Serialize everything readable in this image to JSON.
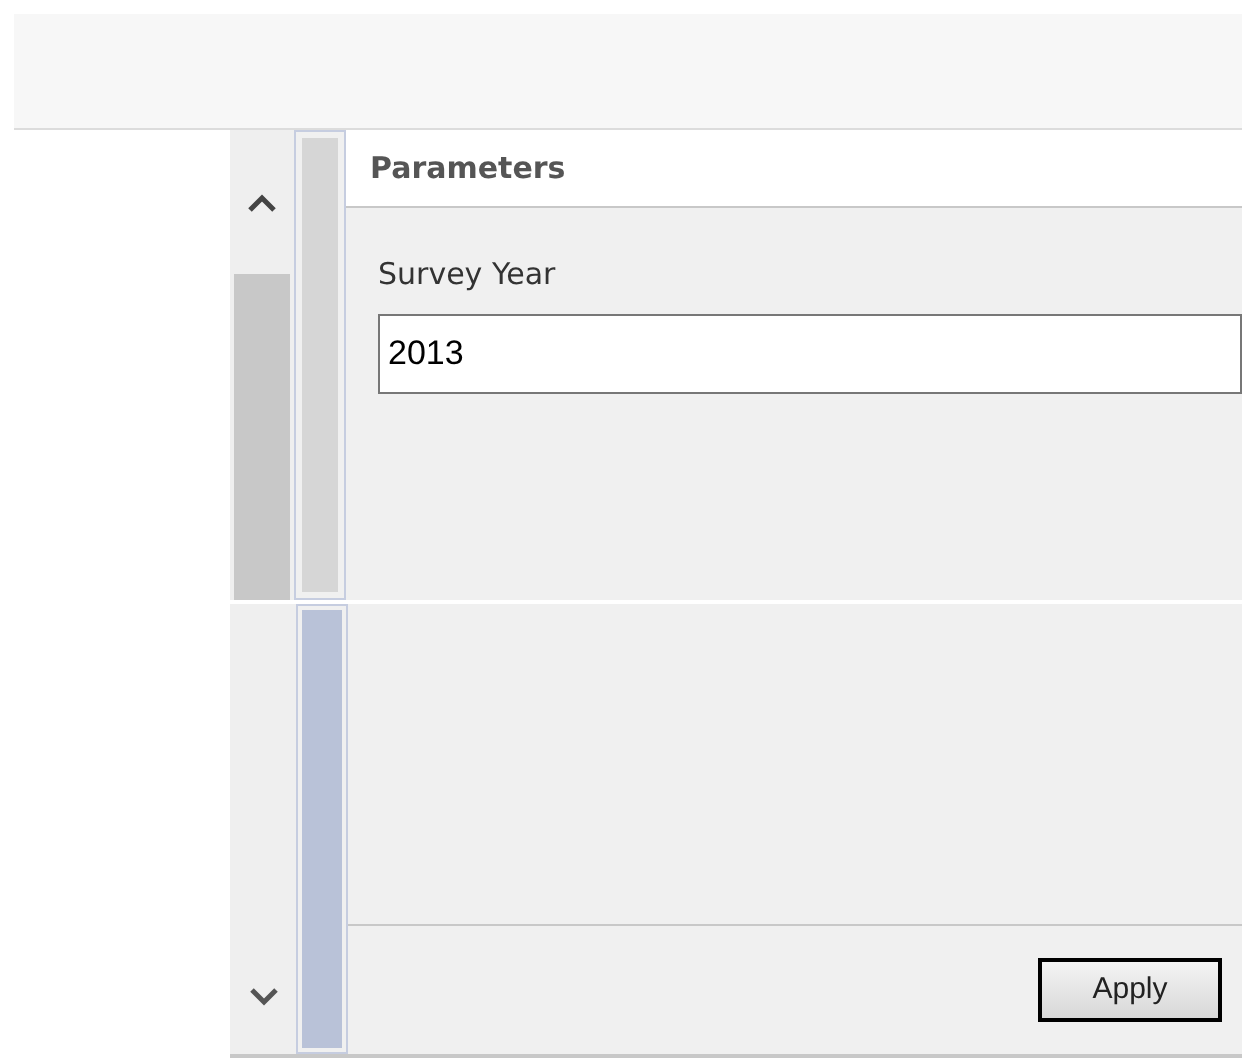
{
  "panel": {
    "title": "Parameters"
  },
  "fields": [
    {
      "label": "Survey Year",
      "value": "2013"
    }
  ],
  "buttons": [
    "Apply"
  ]
}
